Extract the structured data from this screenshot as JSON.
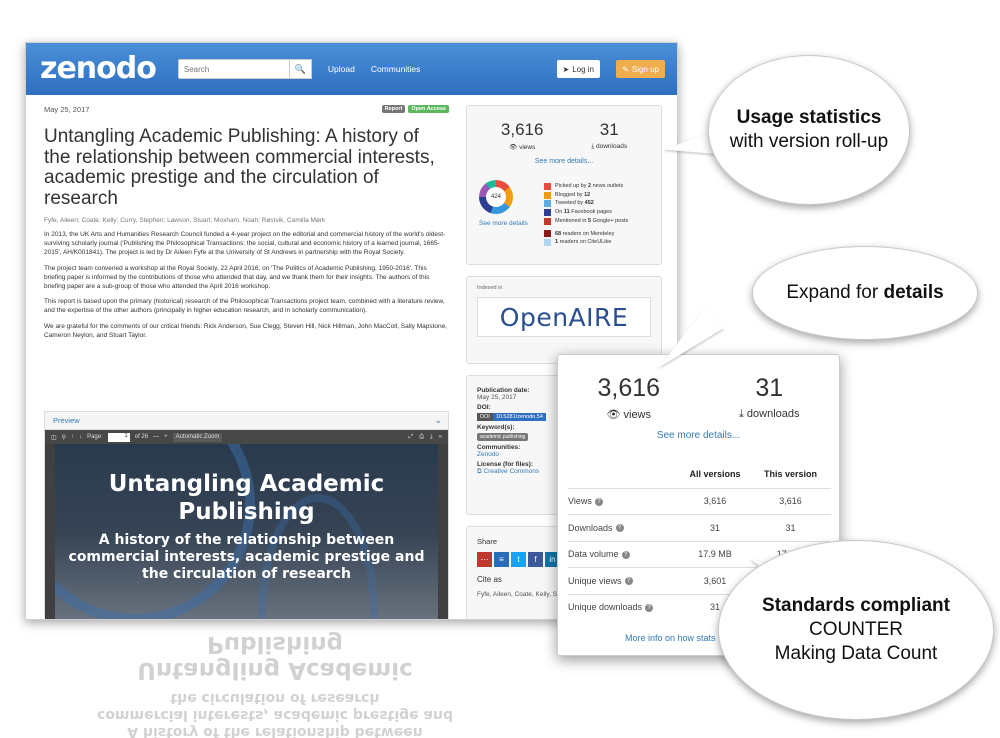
{
  "header": {
    "logo": "zenodo",
    "search_placeholder": "Search",
    "nav": [
      "Upload",
      "Communities"
    ],
    "login": "Log in",
    "signup": "Sign up"
  },
  "record": {
    "date": "May 25, 2017",
    "badges": [
      "Report",
      "Open Access"
    ],
    "title": "Untangling Academic Publishing: A history of the relationship between commercial interests, academic prestige and the circulation of research",
    "authors": "Fyfe, Aileen; Coate, Kelly; Curry, Stephen; Lawson, Stuart; Moxham, Noah; Røstvik, Camilla Mørk",
    "paragraphs": [
      "In 2013, the UK Arts and Humanities Research Council funded a 4-year project on the editorial and commercial history of the world's oldest-surviving scholarly journal ('Publishing the Philosophical Transactions: the social, cultural and economic history of a learned journal, 1665-2015', AH/K001841). The project is led by Dr Aileen Fyfe at the University of St Andrews in partnership with the Royal Society.",
      "The project team convened a workshop at the Royal Society, 22 April 2016, on 'The Politics of Academic Publishing, 1950-2016'. This briefing paper is informed by the contributions of those who attended that day, and we thank them for their insights. The authors of this briefing paper are a sub-group of those who attended the April 2016 workshop.",
      "This report is based upon the primary (historical) research of the Philosophical Transactions project team, combined with a literature review, and the expertise of the other authors (principally in higher education research, and in scholarly communication).",
      "We are grateful for the comments of our critical friends: Rick Anderson, Sue Clegg, Steven Hill, Nick Hillman, John MacColl, Sally Mapstone, Cameron Neylon, and Stuart Taylor."
    ]
  },
  "preview": {
    "label": "Preview",
    "page_label": "Page:",
    "page": "1",
    "of": "of 26",
    "zoom": "Automatic Zoom",
    "cover_title": "Untangling Academic Publishing",
    "cover_subtitle": "A history of the relationship between commercial interests, academic prestige and the circulation of research"
  },
  "stats": {
    "views": "3,616",
    "views_label": "views",
    "downloads": "31",
    "downloads_label": "downloads",
    "see_more": "See more details...",
    "altmetric_score": "424",
    "altmetric_link": "See more details",
    "altmetric": [
      {
        "color": "#e74c3c",
        "pre": "Picked up by ",
        "num": "2",
        "post": " news outlets"
      },
      {
        "color": "#f39c12",
        "pre": "Blogged by ",
        "num": "12",
        "post": ""
      },
      {
        "color": "#5dade2",
        "pre": "Tweeted by ",
        "num": "452",
        "post": ""
      },
      {
        "color": "#2c3e8f",
        "pre": "On ",
        "num": "11",
        "post": " Facebook pages"
      },
      {
        "color": "#c0392b",
        "pre": "Mentioned in ",
        "num": "5",
        "post": " Google+ posts"
      },
      {
        "color": "#8b1a1a",
        "pre": "",
        "num": "68",
        "post": " readers on Mendeley"
      },
      {
        "color": "#aed6f1",
        "pre": "",
        "num": "1",
        "post": " readers on CiteULike"
      }
    ]
  },
  "openaire": {
    "indexed": "Indexed in",
    "logo": "OpenAIRE"
  },
  "meta": {
    "pub_date_label": "Publication date:",
    "pub_date": "May 25, 2017",
    "doi_label": "DOI:",
    "doi_prefix": "DOI",
    "doi": "10.5281/zenodo.54",
    "keywords_label": "Keyword(s):",
    "keyword": "academic publishing",
    "communities_label": "Communities:",
    "community": "Zenodo",
    "license_label": "License (for files):",
    "license": "Creative Commons"
  },
  "share": {
    "label": "Share",
    "cite_as": "Cite as",
    "citation": "Fyfe, Aileen, Coate, Kelly, Stuart, Moxham, Noah, &"
  },
  "details": {
    "views": "3,616",
    "views_label": "views",
    "downloads": "31",
    "downloads_label": "downloads",
    "see_more": "See more details...",
    "columns": [
      "",
      "All versions",
      "This version"
    ],
    "rows": [
      {
        "label": "Views",
        "all": "3,616",
        "this": "3,616"
      },
      {
        "label": "Downloads",
        "all": "31",
        "this": "31"
      },
      {
        "label": "Data volume",
        "all": "17.9 MB",
        "this": "17.9 M"
      },
      {
        "label": "Unique views",
        "all": "3,601",
        "this": ""
      },
      {
        "label": "Unique downloads",
        "all": "31",
        "this": ""
      }
    ],
    "more_info": "More info on how stats"
  },
  "callouts": {
    "usage_bold": "Usage statistics",
    "usage_rest": "with version roll-up",
    "expand_pre": "Expand for ",
    "expand_bold": "details",
    "std_bold": "Standards compliant",
    "std_line2": "COUNTER",
    "std_line3": "Making Data Count"
  }
}
